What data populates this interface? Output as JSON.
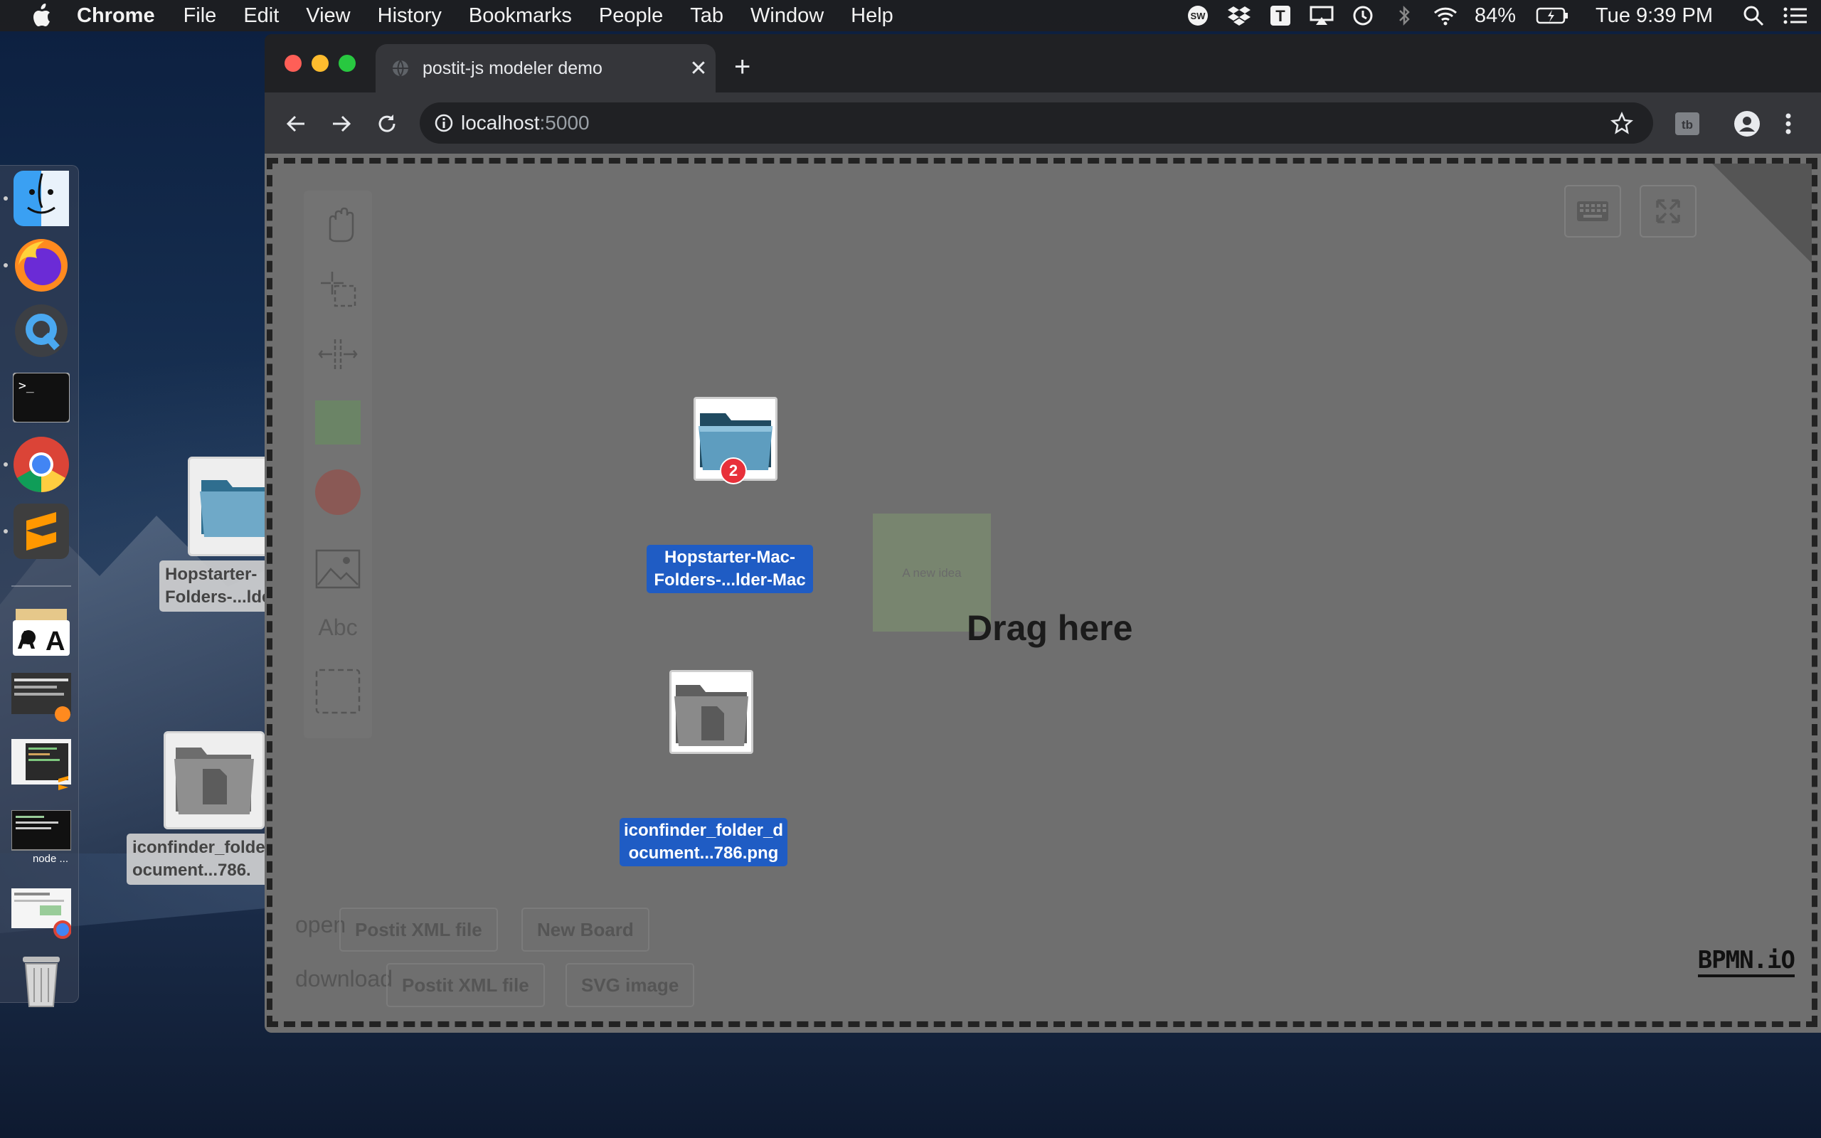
{
  "menubar": {
    "app_name": "Chrome",
    "menus": [
      "File",
      "Edit",
      "View",
      "History",
      "Bookmarks",
      "People",
      "Tab",
      "Window",
      "Help"
    ],
    "battery": "84%",
    "clock": "Tue 9:39 PM"
  },
  "dock": {
    "node_label": "node ..."
  },
  "desktop": {
    "icon1_label": "Hopstarter-Mac-Folders-...lder-Mac",
    "icon1_label_visible": "Hopstarter-\nFolders-...lde",
    "icon2_label_visible": "iconfinder_folde\nocument...786.",
    "icon1_line1": "Hopstarter-",
    "icon1_line2": "Folders-...lde",
    "icon2_line1": "iconfinder_folde",
    "icon2_line2": "ocument...786."
  },
  "browser": {
    "tab_title": "postit-js modeler demo",
    "url_host": "localhost",
    "url_port": ":5000"
  },
  "page": {
    "palette_text_tool": "Abc",
    "postit_text": "A new idea",
    "drop_hint": "Drag here",
    "drag_items": [
      {
        "line1": "Hopstarter-Mac-",
        "line2": "Folders-...lder-Mac",
        "badge": "2"
      },
      {
        "line1": "iconfinder_folder_d",
        "line2": "ocument...786.png"
      }
    ],
    "open_label": "open",
    "open_buttons": [
      "Postit XML file",
      "New Board"
    ],
    "download_label": "download",
    "download_buttons": [
      "Postit XML file",
      "SVG image"
    ],
    "logo": "BPMN.iO"
  },
  "colors": {
    "selection_blue": "#1f5cc4",
    "badge_red": "#e8303a",
    "postit_green": "#7a8a70"
  }
}
